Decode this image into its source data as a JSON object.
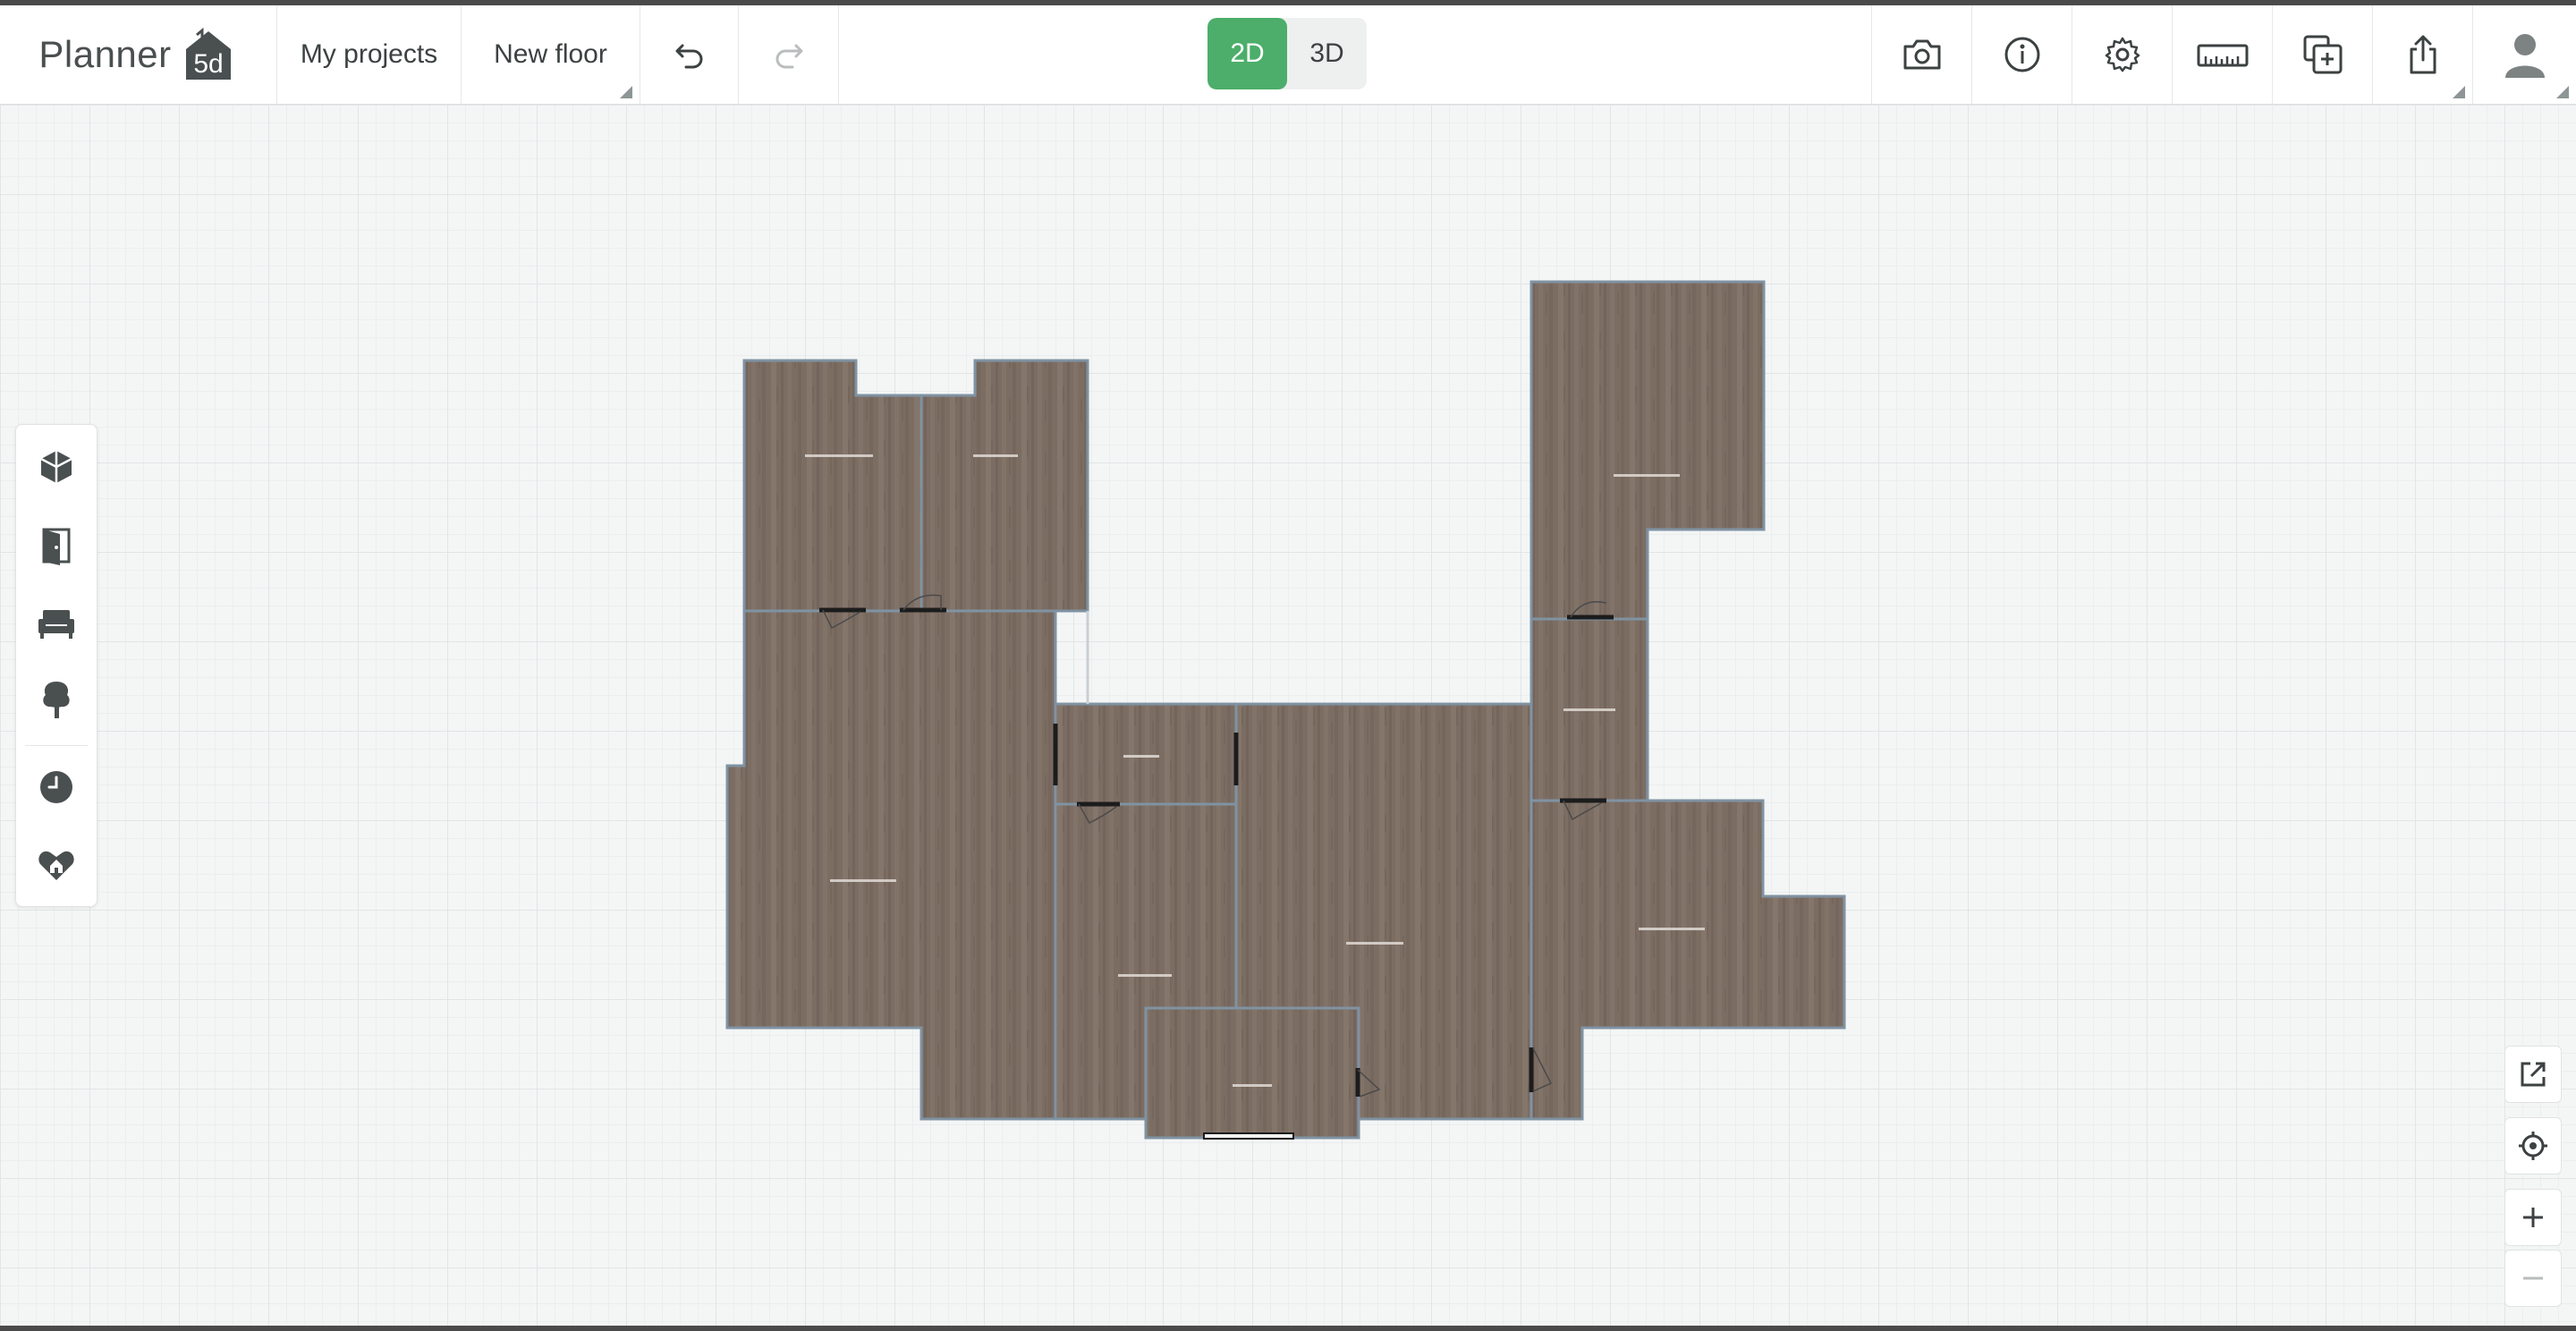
{
  "app": {
    "brand": "Planner",
    "brand_badge": "5d"
  },
  "topbar": {
    "my_projects_label": "My projects",
    "floor_label": "New floor",
    "undo_icon": "undo-icon",
    "redo_icon": "redo-icon",
    "view_modes": [
      {
        "label": "2D",
        "active": true
      },
      {
        "label": "3D",
        "active": false
      }
    ],
    "right_icons": [
      "camera-icon",
      "info-icon",
      "gear-icon",
      "ruler-icon",
      "add-copy-icon",
      "share-icon",
      "user-avatar-icon"
    ]
  },
  "left_toolbar": {
    "items": [
      "construction-icon",
      "door-icon",
      "furniture-sofa-icon",
      "tree-icon",
      "clock-icon",
      "heart-home-icon"
    ]
  },
  "right_controls": {
    "items": [
      "expand-icon",
      "locate-icon",
      "zoom-in-icon",
      "zoom-out-icon"
    ]
  },
  "colors": {
    "accent_green": "#4cae6a",
    "floor_brown": "#7c6d63",
    "wall_blue": "#7f93a3",
    "canvas_bg": "#f4f6f6"
  }
}
